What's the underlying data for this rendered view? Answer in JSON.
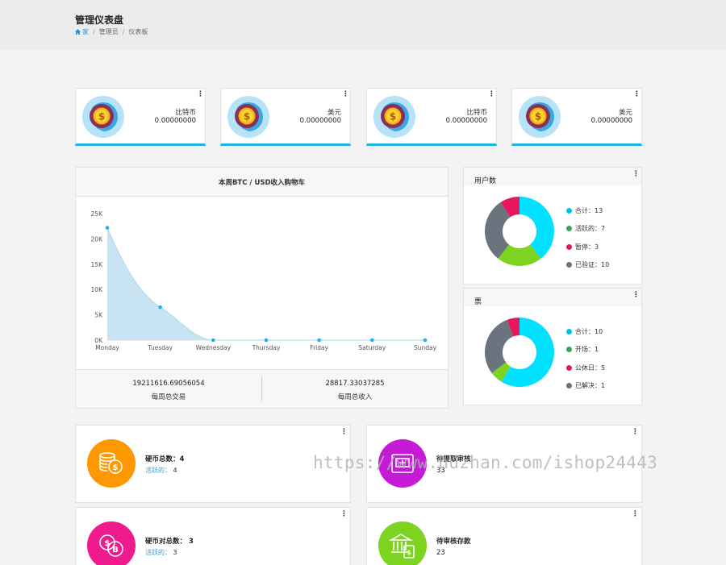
{
  "header": {
    "title": "管理仪表盘",
    "breadcrumb": [
      "家",
      "管理员",
      "仪表板"
    ]
  },
  "stat_cards": [
    {
      "label": "比特币",
      "value": "0.00000000"
    },
    {
      "label": "美元",
      "value": "0.00000000"
    },
    {
      "label": "比特币",
      "value": "0.00000000"
    },
    {
      "label": "美元",
      "value": "0.00000000"
    }
  ],
  "weekly_chart": {
    "title": "本周BTC / USD收入购物车",
    "total_trade_value": "19211616.69056054",
    "total_trade_label": "每周总交易",
    "total_income_value": "28817.33037285",
    "total_income_label": "每周总收入"
  },
  "chart_data": {
    "type": "area",
    "categories": [
      "Monday",
      "Tuesday",
      "Wednesday",
      "Thursday",
      "Friday",
      "Saturday",
      "Sunday"
    ],
    "values": [
      22200,
      6500,
      0,
      0,
      0,
      0,
      0
    ],
    "y_ticks": [
      "0K",
      "5K",
      "10K",
      "15K",
      "20K",
      "25K"
    ],
    "ylim": [
      0,
      25000
    ],
    "color": "#1fb0e8",
    "fill": "#c8e4f2"
  },
  "users_card": {
    "title": "用户数",
    "legend": [
      {
        "label": "合计：13",
        "color": "#00c2f0",
        "value": 13
      },
      {
        "label": "活跃的：7",
        "color": "#3aa655",
        "value": 7
      },
      {
        "label": "暂停：3",
        "color": "#e8175d",
        "value": 3
      },
      {
        "label": "已验证：10",
        "color": "#6a737e",
        "value": 10
      }
    ],
    "slices": [
      {
        "value": 13,
        "color": "#00e0ff"
      },
      {
        "value": 7,
        "color": "#7ed321"
      },
      {
        "value": 10,
        "color": "#6a737e"
      },
      {
        "value": 3,
        "color": "#e8175d"
      }
    ]
  },
  "tickets_card": {
    "title": "票",
    "legend": [
      {
        "label": "合计：10",
        "color": "#00c2f0",
        "value": 10
      },
      {
        "label": "开场：1",
        "color": "#3aa655",
        "value": 1
      },
      {
        "label": "公休日：5",
        "color": "#e8175d",
        "value": 5
      },
      {
        "label": "已解决：1",
        "color": "#6a737e",
        "value": 1
      }
    ],
    "slices": [
      {
        "value": 10,
        "color": "#00e0ff"
      },
      {
        "value": 1,
        "color": "#7ed321"
      },
      {
        "value": 5,
        "color": "#6a737e"
      },
      {
        "value": 1,
        "color": "#e8175d"
      }
    ]
  },
  "info_cards": [
    {
      "title": "硬币总数：",
      "count": "4",
      "sub_label": "活跃的：",
      "sub_value": "4",
      "color": "#ff9800",
      "icon": "coins-icon"
    },
    {
      "title": "待提取审核",
      "count": "33",
      "color": "#c51ad6",
      "icon": "atm-withdraw-icon"
    },
    {
      "title": "硬币对总数：",
      "count": "3",
      "sub_label": "活跃的：",
      "sub_value": "3",
      "color": "#ef1a8e",
      "icon": "coin-pairs-icon"
    },
    {
      "title": "待审核存款",
      "count": "23",
      "color": "#7ed321",
      "icon": "bank-deposit-icon"
    }
  ],
  "watermark": "https://www.huzhan.com/ishop24443"
}
